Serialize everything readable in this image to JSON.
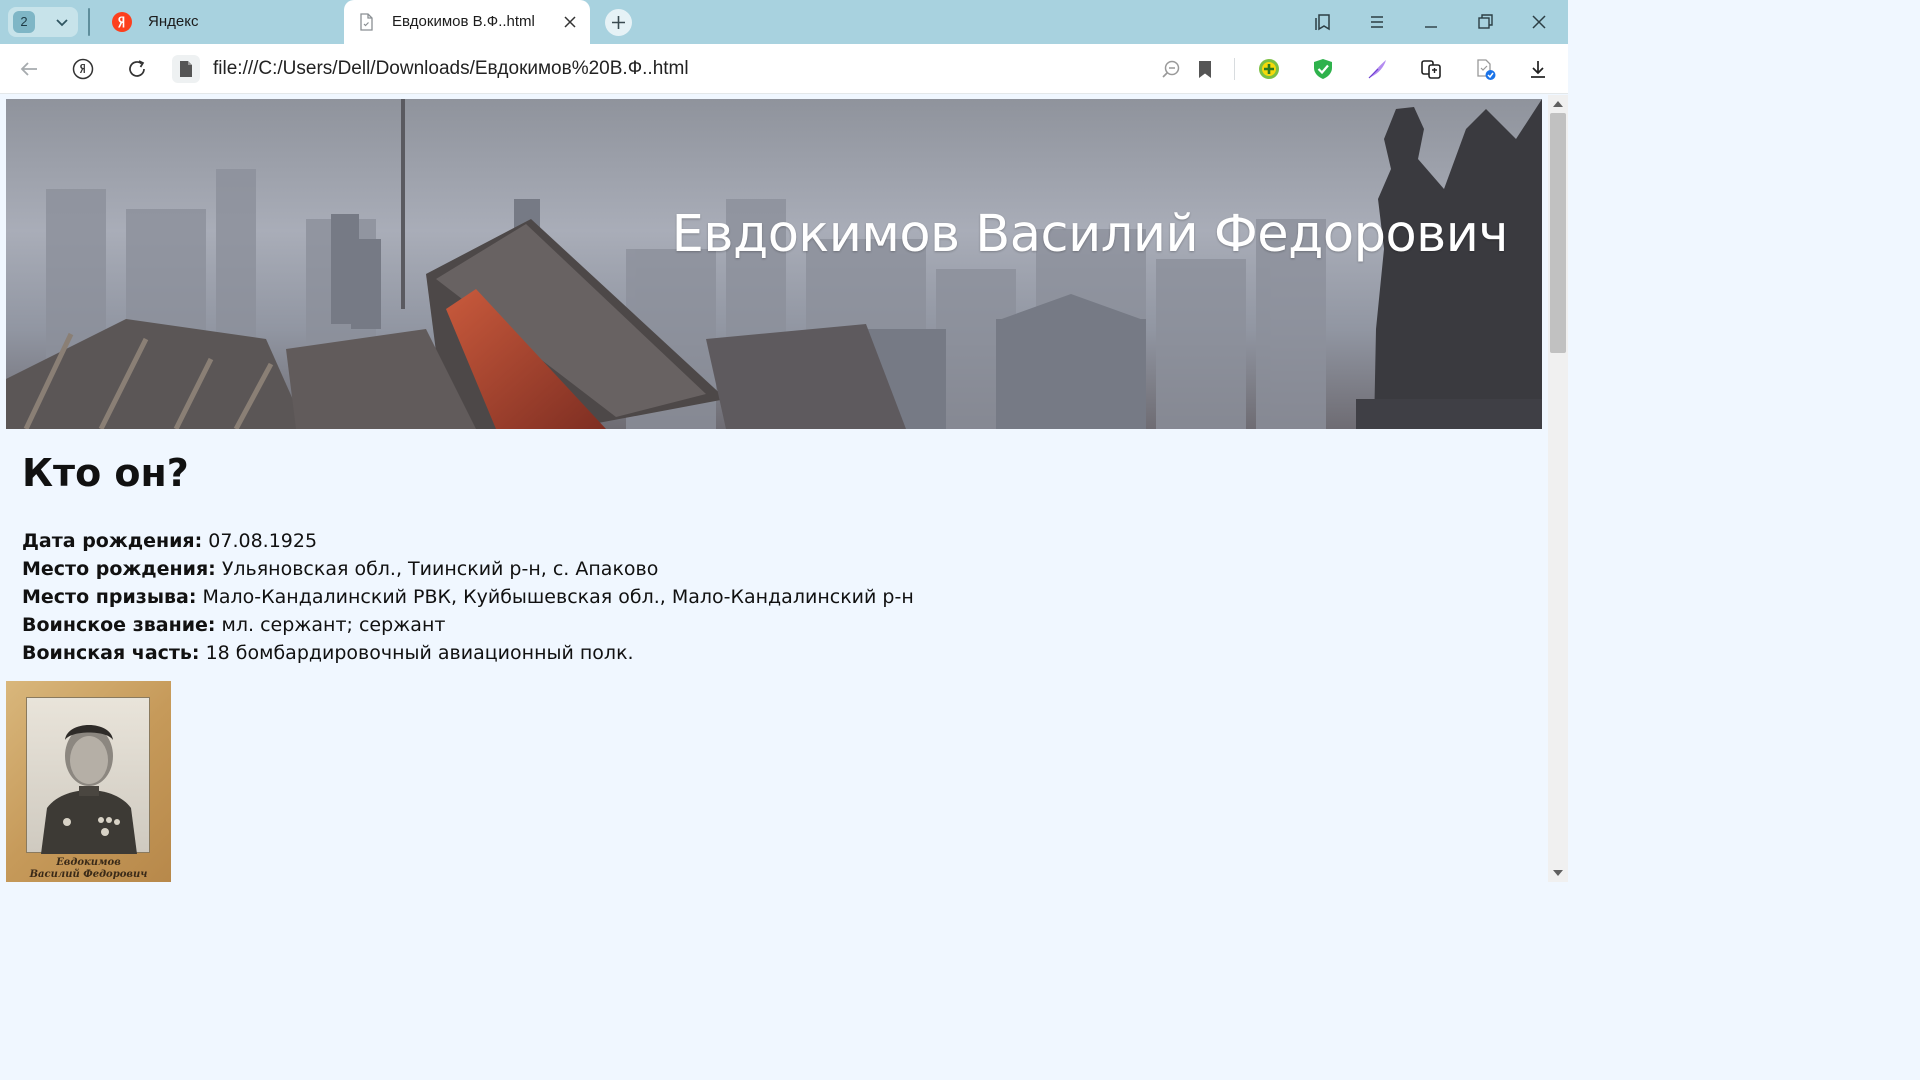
{
  "tabs": {
    "count": "2",
    "items": [
      {
        "title": "Яндекс"
      },
      {
        "title": "Евдокимов В.Ф..html"
      }
    ]
  },
  "address_bar": {
    "url": "file:///C:/Users/Dell/Downloads/Евдокимов%20В.Ф..html"
  },
  "page": {
    "banner_title": "Евдокимов Василий Федорович",
    "section_title": "Кто он?",
    "facts": [
      {
        "label": "Дата рождения:",
        "value": " 07.08.1925"
      },
      {
        "label": "Место рождения:",
        "value": " Ульяновская обл., Тиинский р-н, с. Апаково"
      },
      {
        "label": "Место призыва:",
        "value": " Мало-Кандалинский РВК, Куйбышевская обл., Мало-Кандалинский р-н"
      },
      {
        "label": "Воинское звание:",
        "value": " мл. сержант; сержант"
      },
      {
        "label": "Воинская часть:",
        "value": " 18 бомбардировочный авиационный полк."
      }
    ],
    "portrait_caption_line1": "Евдокимов",
    "portrait_caption_line2": "Василий Федорович"
  },
  "icons": {
    "toolbar": [
      "back-arrow-icon",
      "yandex-logo-icon",
      "reload-icon",
      "file-icon",
      "zoom-icon",
      "bookmark-icon",
      "extension-plus-icon",
      "shield-check-icon",
      "feather-icon",
      "translate-icon",
      "page-check-icon",
      "download-icon"
    ],
    "window": [
      "collections-icon",
      "menu-icon",
      "minimize-icon",
      "restore-icon",
      "close-icon"
    ]
  },
  "colors": {
    "tabstrip": "#a8d2df",
    "page_background": "#f0f7ff",
    "yandex_red": "#fc3f1d"
  }
}
